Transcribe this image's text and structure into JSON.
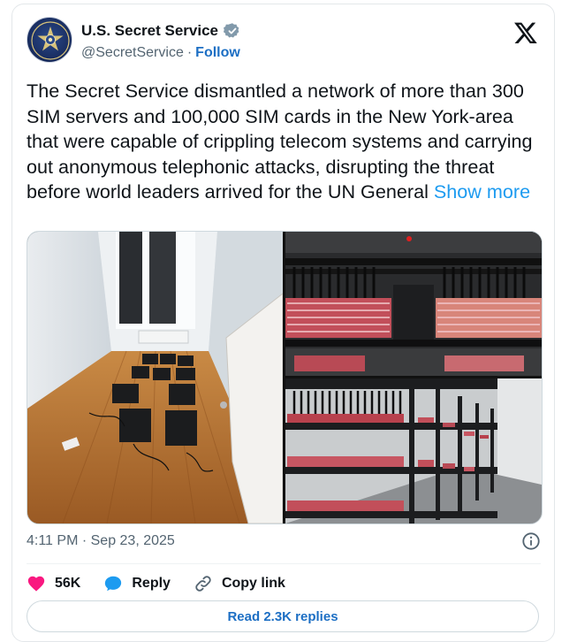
{
  "account": {
    "name": "U.S. Secret Service",
    "handle": "@SecretService",
    "separator": "·",
    "follow_label": "Follow"
  },
  "tweet": {
    "text": "The Secret Service dismantled a network of more than 300 SIM servers and 100,000 SIM cards in the New York-area that were capable of crippling telecom systems and carrying out anonymous telephonic attacks, disrupting the threat before world leaders arrived for the UN General",
    "show_more_label": "Show more",
    "timestamp": "4:11 PM · Sep 23, 2025"
  },
  "actions": {
    "likes": "56K",
    "reply_label": "Reply",
    "copy_link_label": "Copy link"
  },
  "read_replies_label": "Read 2.3K replies",
  "colors": {
    "accent": "#1d9bf0",
    "heart": "#f91880",
    "reply_bubble": "#1d9bf0",
    "verified": "#829aab"
  },
  "icons": {
    "verified": "verified-badge-icon",
    "logo": "x-logo-icon",
    "info": "info-icon",
    "like": "heart-icon",
    "reply": "reply-bubble-icon",
    "copy_link": "link-icon"
  }
}
